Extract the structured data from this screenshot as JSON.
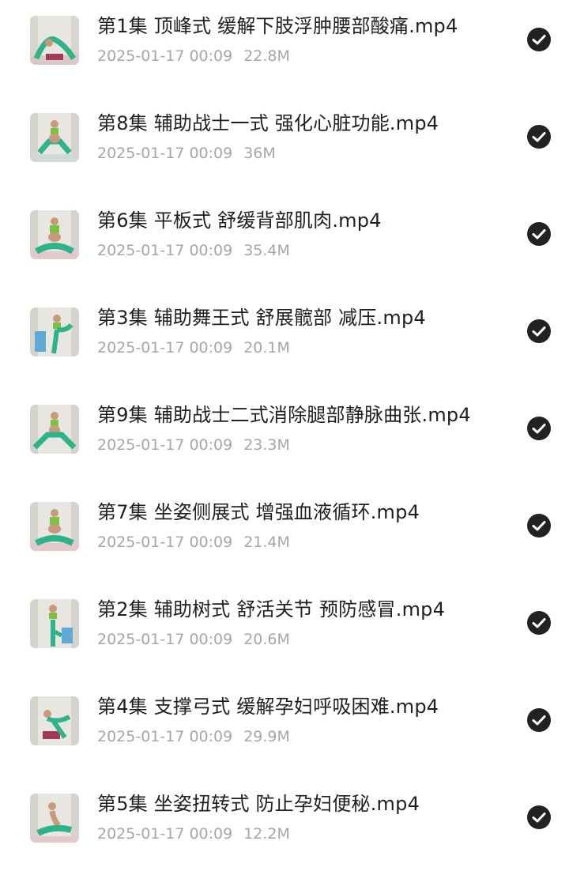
{
  "files": [
    {
      "name": "第1集 顶峰式 缓解下肢浮肿腰部酸痛.mp4",
      "date": "2025-01-17 00:09",
      "size": "22.8M",
      "checked": true
    },
    {
      "name": "第8集 辅助战士一式 强化心脏功能.mp4",
      "date": "2025-01-17 00:09",
      "size": "36M",
      "checked": true
    },
    {
      "name": "第6集 平板式 舒缓背部肌肉.mp4",
      "date": "2025-01-17 00:09",
      "size": "35.4M",
      "checked": true
    },
    {
      "name": "第3集 辅助舞王式 舒展髋部 减压.mp4",
      "date": "2025-01-17 00:09",
      "size": "20.1M",
      "checked": true
    },
    {
      "name": "第9集 辅助战士二式消除腿部静脉曲张.mp4",
      "date": "2025-01-17 00:09",
      "size": "23.3M",
      "checked": true
    },
    {
      "name": "第7集 坐姿侧展式 增强血液循环.mp4",
      "date": "2025-01-17 00:09",
      "size": "21.4M",
      "checked": true
    },
    {
      "name": "第2集 辅助树式 舒活关节 预防感冒.mp4",
      "date": "2025-01-17 00:09",
      "size": "20.6M",
      "checked": true
    },
    {
      "name": "第4集 支撑弓式 缓解孕妇呼吸困难.mp4",
      "date": "2025-01-17 00:09",
      "size": "29.9M",
      "checked": true
    },
    {
      "name": "第5集 坐姿扭转式 防止孕妇便秘.mp4",
      "date": "2025-01-17 00:09",
      "size": "12.2M",
      "checked": true
    }
  ],
  "icons": {
    "check": "check-circle-icon",
    "thumbnail": "video-thumbnail"
  },
  "colors": {
    "title": "#1f1f1f",
    "meta": "#a6a6a6",
    "check_fill": "#222222",
    "outfit": "#2fb38b",
    "top": "#7cc242"
  }
}
